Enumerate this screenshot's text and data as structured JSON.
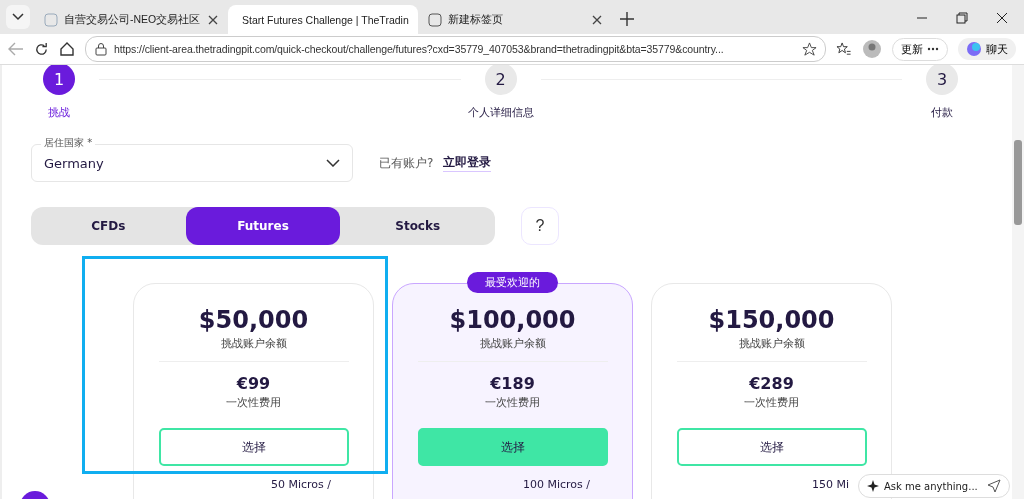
{
  "browser": {
    "tabs": [
      {
        "title": "自营交易公司-NEO交易社区",
        "selected": false
      },
      {
        "title": "Start Futures Challenge | TheTradin",
        "selected": true
      },
      {
        "title": "新建标签页",
        "selected": false
      }
    ],
    "url": "https://client-area.thetradingpit.com/quick-checkout/challenge/futures?cxd=35779_407053&brand=thetradingpit&bta=35779&country...",
    "update_label": "更新",
    "chat_label": "聊天"
  },
  "steps": [
    {
      "number": "1",
      "label": "挑战",
      "selected": true
    },
    {
      "number": "2",
      "label": "个人详细信息",
      "selected": false
    },
    {
      "number": "3",
      "label": "付款",
      "selected": false
    }
  ],
  "country_field": {
    "label": "居住国家 *",
    "value": "Germany"
  },
  "login": {
    "prompt": "已有账户?",
    "link": "立即登录"
  },
  "market_tabs": [
    {
      "label": "CFDs",
      "selected": false
    },
    {
      "label": "Futures",
      "selected": true
    },
    {
      "label": "Stocks",
      "selected": false
    }
  ],
  "help_button": "?",
  "plans": [
    {
      "amount": "$50,000",
      "amount_label": "挑战账户余额",
      "price": "€99",
      "price_label": "一次性费用",
      "button": "选择",
      "popular": false,
      "micros": "50 Micros  /",
      "outlined": true
    },
    {
      "badge": "最受欢迎的",
      "amount": "$100,000",
      "amount_label": "挑战账户余额",
      "price": "€189",
      "price_label": "一次性费用",
      "button": "选择",
      "popular": true,
      "micros": "100 Micros  /"
    },
    {
      "amount": "$150,000",
      "amount_label": "挑战账户余额",
      "price": "€289",
      "price_label": "一次性费用",
      "button": "选择",
      "popular": false,
      "micros": "150 Mi"
    }
  ],
  "chat_box": {
    "placeholder": "Ask me anything..."
  }
}
